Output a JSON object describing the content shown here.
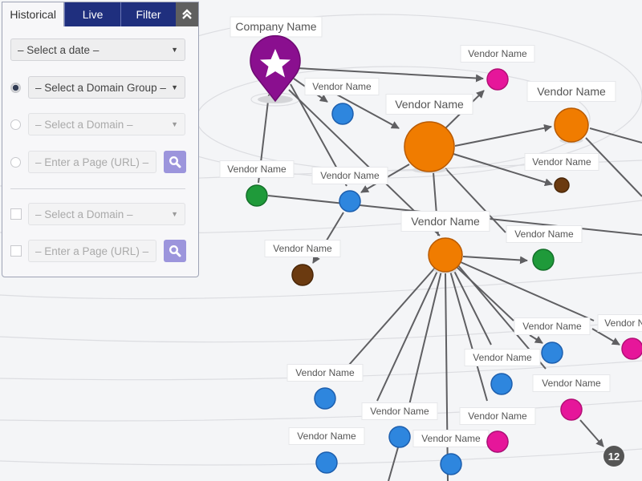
{
  "panel": {
    "tabs": [
      {
        "label": "Historical",
        "active": true
      },
      {
        "label": "Live",
        "active": false
      },
      {
        "label": "Filter",
        "active": false
      }
    ],
    "collapse_icon": "double-chevron-up-icon",
    "date_select": {
      "value": "– Select a date –"
    },
    "domain_group_select": {
      "value": "– Select a Domain Group –",
      "radio_selected": true
    },
    "domain_select": {
      "value": "– Select a Domain –",
      "radio_selected": false,
      "disabled": true
    },
    "page_input": {
      "placeholder": "– Enter a Page (URL) –",
      "radio_selected": false,
      "disabled": true
    },
    "compare_domain_select": {
      "value": "– Select a Domain –",
      "checked": false,
      "disabled": true
    },
    "compare_page_input": {
      "placeholder": "– Enter a Page (URL) –",
      "checked": false,
      "disabled": true
    },
    "search_icon": "search-icon"
  },
  "colors": {
    "company": "#8a0f8f",
    "orange": "#f07c00",
    "blue": "#2e86de",
    "pink": "#e6169a",
    "green": "#1f9a3a",
    "brown": "#6b3a10",
    "count": "#555555",
    "tab_dark": "#1f2f7e",
    "search_btn": "#9c95dc"
  },
  "graph": {
    "company": {
      "label": "Company Name",
      "icon": "star-icon"
    },
    "nodes": [
      {
        "id": "n1",
        "label": "Vendor Name",
        "color": "pink"
      },
      {
        "id": "n2",
        "label": "Vendor Name",
        "color": "blue"
      },
      {
        "id": "n3",
        "label": "Vendor Name",
        "color": "orange"
      },
      {
        "id": "n4",
        "label": "Vendor Name",
        "color": "orange"
      },
      {
        "id": "n5",
        "label": "Vendor Name",
        "color": "brown"
      },
      {
        "id": "n6",
        "label": "Vendor Name",
        "color": "green"
      },
      {
        "id": "n7",
        "label": "Vendor Name",
        "color": "blue"
      },
      {
        "id": "n8",
        "label": "Vendor Name",
        "color": "orange"
      },
      {
        "id": "n9",
        "label": "Vendor Name",
        "color": "brown"
      },
      {
        "id": "n10",
        "label": "Vendor Name",
        "color": "green"
      },
      {
        "id": "n11",
        "label": "Vendor Name",
        "color": "blue"
      },
      {
        "id": "n12",
        "label": "Vendor Name",
        "color": "pink"
      },
      {
        "id": "n13",
        "label": "Vendor Name",
        "color": "blue"
      },
      {
        "id": "n14",
        "label": "Vendor Name",
        "color": "pink"
      },
      {
        "id": "n15",
        "label": "Vendor Name",
        "color": "blue"
      },
      {
        "id": "n16",
        "label": "Vendor Name",
        "color": "blue"
      },
      {
        "id": "n17",
        "label": "Vendor Name",
        "color": "blue"
      },
      {
        "id": "n18",
        "label": "Vendor Name",
        "color": "pink"
      },
      {
        "id": "n19",
        "label": "Vendor Name",
        "color": "blue"
      },
      {
        "id": "n20",
        "label": "Vendor Name",
        "color": "blue"
      }
    ],
    "overflow_count": "12"
  }
}
